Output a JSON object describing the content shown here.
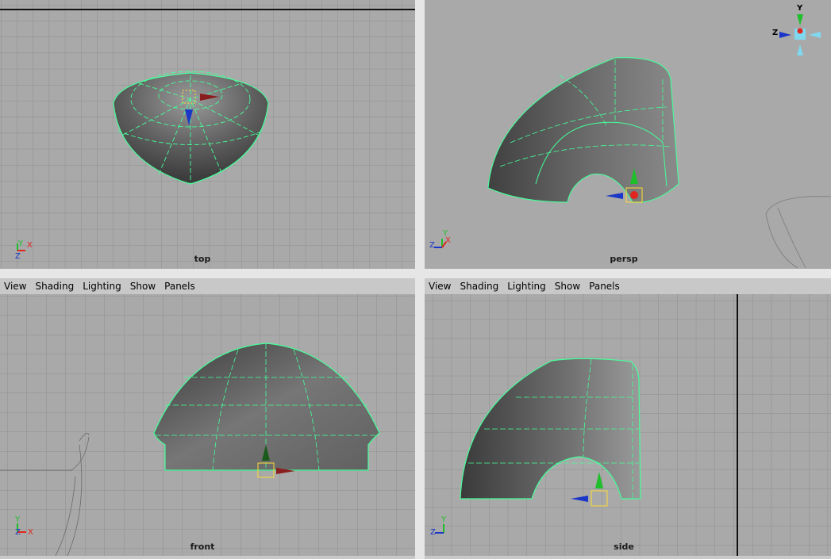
{
  "menus": {
    "view": "View",
    "shading": "Shading",
    "lighting": "Lighting",
    "show": "Show",
    "panels": "Panels"
  },
  "viewports": {
    "top": "top",
    "persp": "persp",
    "front": "front",
    "side": "side"
  },
  "axes": {
    "x": "X",
    "y": "Y",
    "z": "Z"
  },
  "colors": {
    "viewport_bg": "#a9a9a9",
    "grid": "#8f8f8f",
    "wire": "#44ff99",
    "axis_x": "#e0261e",
    "axis_y": "#1fbf2b",
    "axis_z": "#1a37c8"
  },
  "icons": [
    "view-cube-icon",
    "manipulator-icon",
    "axis-gizmo-icon"
  ]
}
